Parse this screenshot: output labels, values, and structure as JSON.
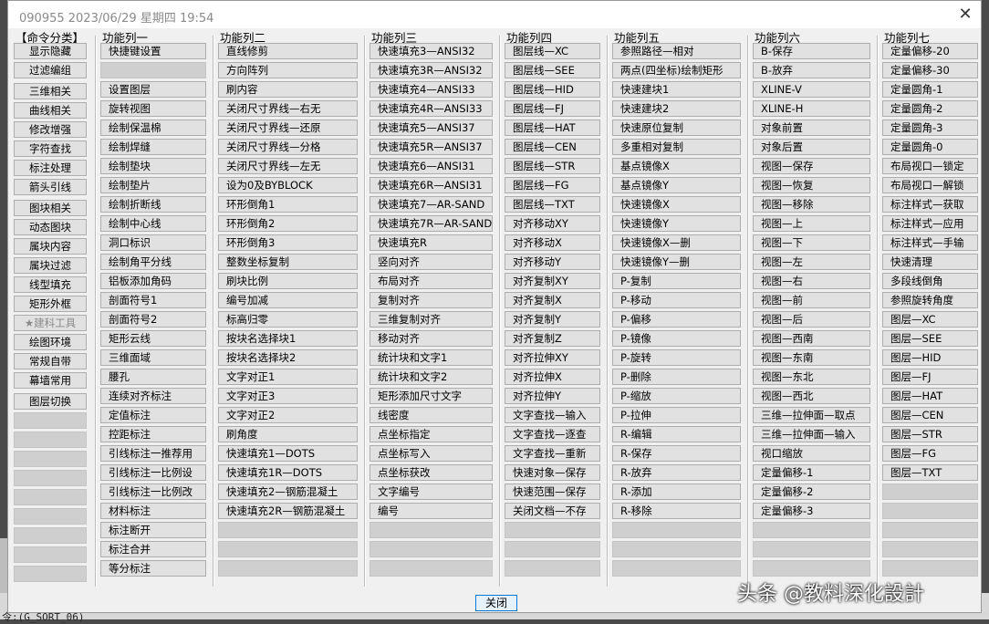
{
  "window": {
    "title": "090955 2023/06/29 星期四 19:54"
  },
  "categories": {
    "header": "【命令分类】",
    "items": [
      "显示隐藏",
      "过滤编组",
      "三维相关",
      "曲线相关",
      "修改增强",
      "字符查找",
      "标注处理",
      "箭头引线",
      "图块相关",
      "动态图块",
      "属块内容",
      "属块过滤",
      "线型填充",
      "矩形外框",
      "★建科工具",
      "绘图环境",
      "常规自带",
      "幕墙常用",
      "图层切换"
    ],
    "disabled_item": "★建科工具"
  },
  "columns": [
    {
      "header": "功能列一",
      "items": [
        "快捷键设置",
        "",
        "设置图层",
        "旋转视图",
        "绘制保温棉",
        "绘制焊缝",
        "绘制垫块",
        "绘制垫片",
        "绘制折断线",
        "绘制中心线",
        "洞口标识",
        "绘制角平分线",
        "铝板添加角码",
        "剖面符号1",
        "剖面符号2",
        "矩形云线",
        "三维面域",
        "腰孔",
        "连续对齐标注",
        "定值标注",
        "控距标注",
        "引线标注一推荐用",
        "引线标注一比例设",
        "引线标注一比例改",
        "材料标注",
        "标注断开",
        "标注合并",
        "等分标注"
      ]
    },
    {
      "header": "功能列二",
      "items": [
        "直线修剪",
        "方向阵列",
        "刷内容",
        "关闭尺寸界线—右无",
        "关闭尺寸界线—还原",
        "关闭尺寸界线—分格",
        "关闭尺寸界线—左无",
        "设为0及BYBLOCK",
        "环形倒角1",
        "环形倒角2",
        "环形倒角3",
        "整数坐标复制",
        "刷块比例",
        "编号加减",
        "标高归零",
        "按块名选择块1",
        "按块名选择块2",
        "文字对正1",
        "文字对正3",
        "文字对正2",
        "刷角度",
        "快速填充1—DOTS",
        "快速填充1R—DOTS",
        "快速填充2—钢筋混凝土",
        "快速填充2R—钢筋混凝土"
      ]
    },
    {
      "header": "功能列三",
      "items": [
        "快速填充3—ANSI32",
        "快速填充3R—ANSI32",
        "快速填充4—ANSI33",
        "快速填充4R—ANSI33",
        "快速填充5—ANSI37",
        "快速填充5R—ANSI37",
        "快速填充6—ANSI31",
        "快速填充6R—ANSI31",
        "快速填充7—AR-SAND",
        "快速填充7R—AR-SAND",
        "快速填充R",
        "竖向对齐",
        "布局对齐",
        "复制对齐",
        "三维复制对齐",
        "移动对齐",
        "统计块和文字1",
        "统计块和文字2",
        "矩形添加尺寸文字",
        "线密度",
        "点坐标指定",
        "点坐标写入",
        "点坐标获改",
        "文字编号",
        "编号"
      ]
    },
    {
      "header": "功能列四",
      "items": [
        "图层线—XC",
        "图层线—SEE",
        "图层线—HID",
        "图层线—FJ",
        "图层线—HAT",
        "图层线—CEN",
        "图层线—STR",
        "图层线—FG",
        "图层线—TXT",
        "对齐移动XY",
        "对齐移动X",
        "对齐移动Y",
        "对齐复制XY",
        "对齐复制X",
        "对齐复制Y",
        "对齐复制Z",
        "对齐拉伸XY",
        "对齐拉伸X",
        "对齐拉伸Y",
        "文字查找—输入",
        "文字查找—逐查",
        "文字查找—重新",
        "快速对象—保存",
        "快速范围—保存",
        "关闭文档—不存"
      ]
    },
    {
      "header": "功能列五",
      "items": [
        "参照路径—相对",
        "两点(四坐标)绘制矩形",
        "快速建块1",
        "快速建块2",
        "快速原位复制",
        "多重相对复制",
        "基点镜像X",
        "基点镜像Y",
        "快速镜像X",
        "快速镜像Y",
        "快速镜像X—删",
        "快速镜像Y—删",
        "P-复制",
        "P-移动",
        "P-偏移",
        "P-镜像",
        "P-旋转",
        "P-删除",
        "P-缩放",
        "P-拉伸",
        "R-编辑",
        "R-保存",
        "R-放弃",
        "R-添加",
        "R-移除"
      ]
    },
    {
      "header": "功能列六",
      "items": [
        "B-保存",
        "B-放弃",
        "XLINE-V",
        "XLINE-H",
        "对象前置",
        "对象后置",
        "视图—保存",
        "视图—恢复",
        "视图—移除",
        "视图—上",
        "视图—下",
        "视图—左",
        "视图—右",
        "视图—前",
        "视图—后",
        "视图—西南",
        "视图—东南",
        "视图—东北",
        "视图—西北",
        "三维—拉伸面—取点",
        "三维—拉伸面—输入",
        "视口缩放",
        "定量偏移-1",
        "定量偏移-2",
        "定量偏移-3"
      ]
    },
    {
      "header": "功能列七",
      "items": [
        "定量偏移-20",
        "定量偏移-30",
        "定量圆角-1",
        "定量圆角-2",
        "定量圆角-3",
        "定量圆角-0",
        "布局视口—锁定",
        "布局视口—解锁",
        "标注样式—获取",
        "标注样式—应用",
        "标注样式—手输",
        "快速清理",
        "多段线倒角",
        "参照旋转角度",
        "图层—XC",
        "图层—SEE",
        "图层—HID",
        "图层—FJ",
        "图层—HAT",
        "图层—CEN",
        "图层—STR",
        "图层—FG",
        "图层—TXT"
      ]
    }
  ],
  "footer": {
    "close_label": "关闭"
  },
  "watermark": "头条 @教料深化設計",
  "background_cmd": "令:(G_SORT_06)"
}
